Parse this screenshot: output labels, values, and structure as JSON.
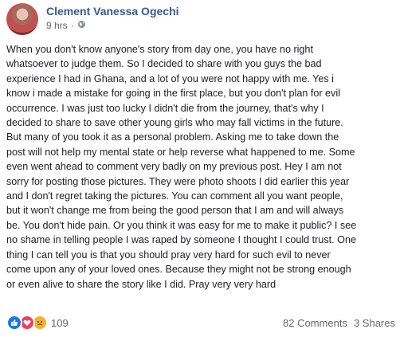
{
  "post": {
    "author": "Clement Vanessa Ogechi",
    "time": "9 hrs",
    "separator": "·",
    "privacy_icon": "globe-icon",
    "lines": [
      "When you don't know anyone's story from day one, you have no right",
      "whatsoever to judge them. So I decided to share with you guys the bad",
      "experience I had in Ghana, and a lot of you were not happy with me. Yes i",
      "know i made a mistake for going in the first place, but you don't plan for evil",
      "occurrence. I was just too lucky I didn't die from the journey, that's why I",
      "decided to share to save other young girls who may fall victims in the future.",
      "But many of you took it as a personal problem. Asking me to take down the",
      "post will not help my mental state or help reverse what happened to me. Some",
      "even went ahead to comment very badly on my previous post. Hey I am not",
      "sorry for posting those pictures. They were photo shoots I did earlier this year",
      "and I don't regret taking the pictures. You can comment all you want people,",
      "but it won't change me from being the good person that I am and will always",
      "be. You don't hide pain. Or you think it was easy for me to make it public? I see",
      "no shame in telling people I was raped by someone I thought I could trust. One",
      "thing I can tell you is that you should pray very hard for such evil to never",
      "come upon any of your loved ones. Because they might not be strong enough",
      "or even alive to share the story like I did. Pray very very hard"
    ]
  },
  "footer": {
    "reaction_icons": [
      "like-icon",
      "love-icon",
      "sad-icon"
    ],
    "reaction_count": "109",
    "comments": "82 Comments",
    "shares": "3 Shares"
  },
  "colors": {
    "author": "#385898",
    "meta": "#616770",
    "text": "#1c1e21",
    "like": "#1877f2",
    "love": "#f33e58",
    "sad": "#f7b125"
  }
}
